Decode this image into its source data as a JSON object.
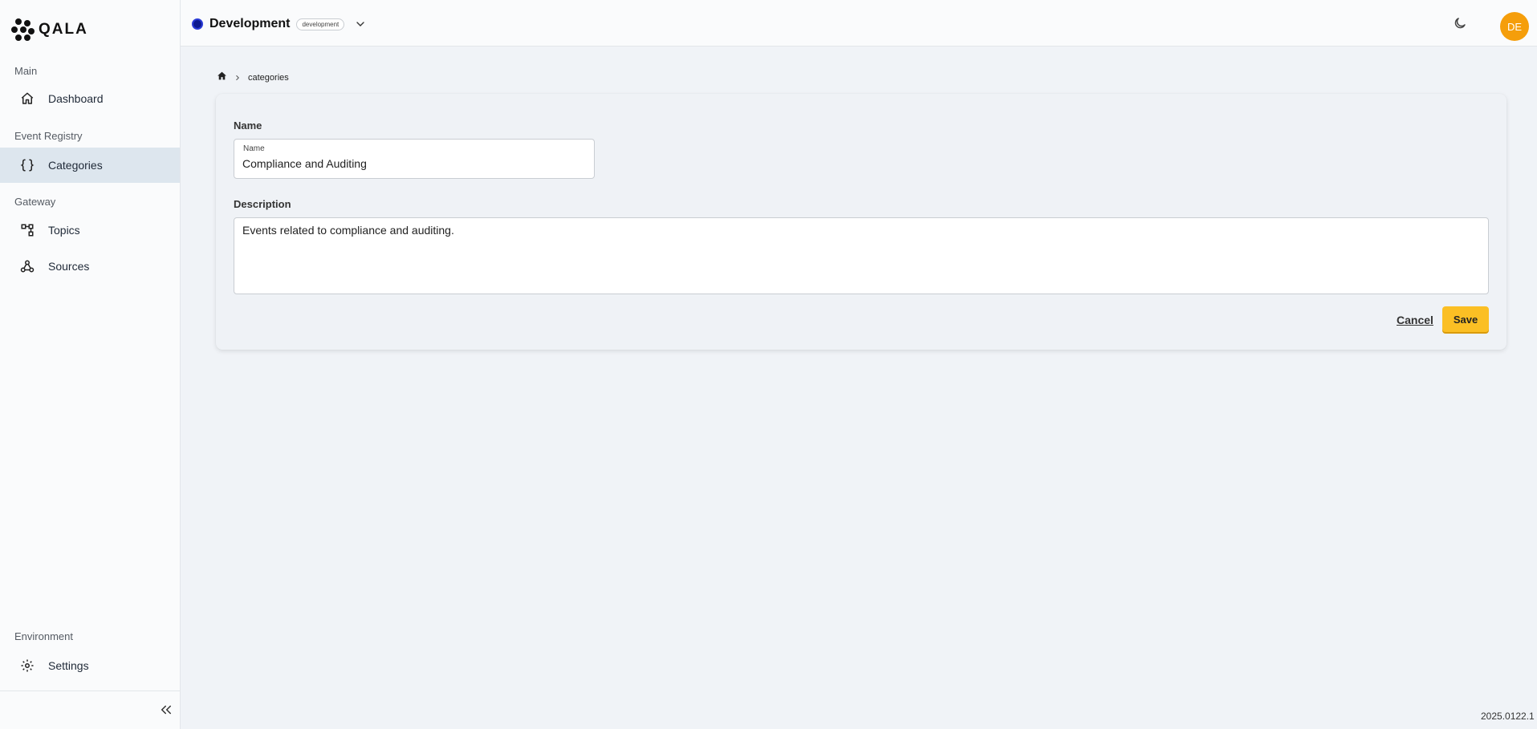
{
  "app": {
    "logo_text": "QALA",
    "version": "2025.0122.1"
  },
  "header": {
    "env_name": "Development",
    "env_badge": "development",
    "avatar_initials": "DE"
  },
  "sidebar": {
    "sections": {
      "main": "Main",
      "event_registry": "Event Registry",
      "gateway": "Gateway",
      "environment": "Environment"
    },
    "items": {
      "dashboard": "Dashboard",
      "categories": "Categories",
      "topics": "Topics",
      "sources": "Sources",
      "settings": "Settings"
    },
    "active_item": "categories"
  },
  "breadcrumb": {
    "current": "categories"
  },
  "form": {
    "name_title": "Name",
    "name_label": "Name",
    "name_value": "Compliance and Auditing",
    "description_title": "Description",
    "description_value": "Events related to compliance and auditing.",
    "cancel_label": "Cancel",
    "save_label": "Save"
  },
  "colors": {
    "accent": "#fbbf24",
    "avatar": "#f59e0b",
    "active_nav_bg": "#dde6ee",
    "env_dot": "#0d1a8f"
  },
  "icons": {
    "logo": "qala-logo-icon",
    "dashboard": "home-icon",
    "categories": "braces-icon",
    "topics": "topology-icon",
    "sources": "webhook-icon",
    "settings": "gear-icon",
    "collapse": "chevrons-left-icon",
    "theme": "moon-icon",
    "env_dropdown": "chevron-down-icon",
    "breadcrumb_home": "home-icon",
    "breadcrumb_sep": "chevron-right-icon"
  }
}
